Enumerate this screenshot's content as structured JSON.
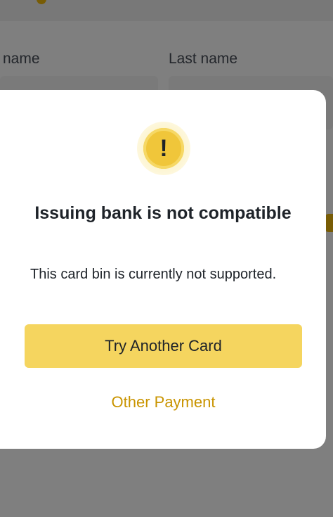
{
  "form": {
    "first_name_label": "name",
    "last_name_label": "Last name"
  },
  "dialog": {
    "icon": "warning-exclamation-icon",
    "icon_glyph": "!",
    "title": "Issuing bank is not compatible",
    "message": "This card bin is currently not supported.",
    "primary_button": "Try Another Card",
    "secondary_button": "Other Payment"
  },
  "colors": {
    "accent": "#f5d55f",
    "link": "#c99400",
    "icon": "#f0c63a"
  }
}
